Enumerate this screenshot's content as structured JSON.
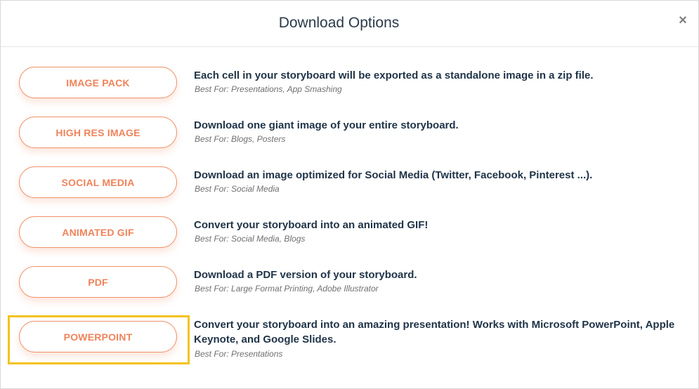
{
  "dialog": {
    "title": "Download Options",
    "close_glyph": "×"
  },
  "options": [
    {
      "label": "IMAGE PACK",
      "description": "Each cell in your storyboard will be exported as a standalone image in a zip file.",
      "best_for": "Best For: Presentations, App Smashing"
    },
    {
      "label": "HIGH RES IMAGE",
      "description": "Download one giant image of your entire storyboard.",
      "best_for": "Best For: Blogs, Posters"
    },
    {
      "label": "SOCIAL MEDIA",
      "description": "Download an image optimized for Social Media (Twitter, Facebook, Pinterest ...).",
      "best_for": "Best For: Social Media"
    },
    {
      "label": "ANIMATED GIF",
      "description": "Convert your storyboard into an animated GIF!",
      "best_for": "Best For: Social Media, Blogs"
    },
    {
      "label": "PDF",
      "description": "Download a PDF version of your storyboard.",
      "best_for": "Best For: Large Format Printing, Adobe Illustrator"
    },
    {
      "label": "POWERPOINT",
      "description": "Convert your storyboard into an amazing presentation! Works with Microsoft PowerPoint, Apple Keynote, and Google Slides.",
      "best_for": "Best For: Presentations"
    }
  ],
  "colors": {
    "button_accent": "#f0835a",
    "highlight": "#f5c21b",
    "text_primary": "#1f3347"
  }
}
